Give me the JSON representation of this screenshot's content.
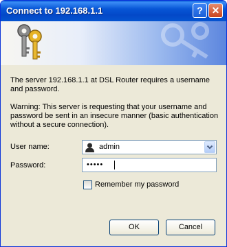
{
  "window": {
    "title": "Connect to 192.168.1.1",
    "help_glyph": "?",
    "close_glyph": "✕"
  },
  "icons": {
    "keys": "keys-icon",
    "user": "user-icon",
    "dropdown": "chevron-down-icon"
  },
  "message": {
    "intro_line1": "The server 192.168.1.1 at DSL Router requires a username",
    "intro_line2": "and password.",
    "warning_line1": "Warning: This server is requesting that your username and",
    "warning_line2": "password be sent in an insecure manner (basic authentication",
    "warning_line3": "without a secure connection)."
  },
  "form": {
    "username_label": "User name:",
    "username_value": "admin",
    "password_label": "Password:",
    "password_value": "•••••",
    "remember_label": "Remember my password",
    "remember_checked": false
  },
  "buttons": {
    "ok": "OK",
    "cancel": "Cancel"
  }
}
